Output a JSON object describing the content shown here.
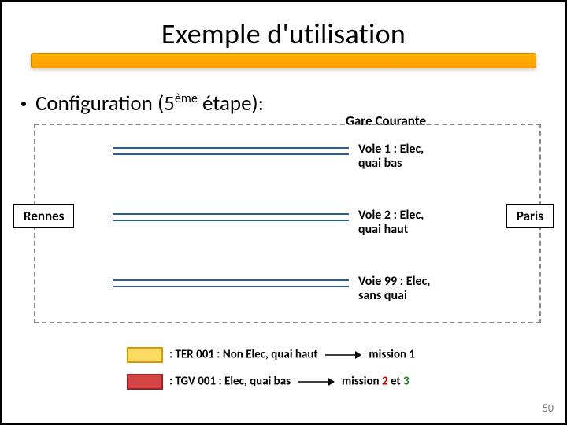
{
  "title": "Exemple d'utilisation",
  "bullet_prefix": "Configuration (5",
  "bullet_sup": "ème",
  "bullet_suffix": " étape):",
  "station": "Gare Courante",
  "tracks": [
    "Voie 1 : Elec, quai bas",
    "Voie 2 : Elec, quai haut",
    "Voie 99 : Elec, sans quai"
  ],
  "city_left": "Rennes",
  "city_right": "Paris",
  "legend": {
    "l1_text": ": TER 001 : Non Elec, quai haut",
    "l1_mission": "mission 1",
    "l2_text": ": TGV 001 : Elec, quai bas",
    "l2_pre": "mission ",
    "l2_m2": "2",
    "l2_mid": " et ",
    "l2_m3": "3"
  },
  "page": "50"
}
